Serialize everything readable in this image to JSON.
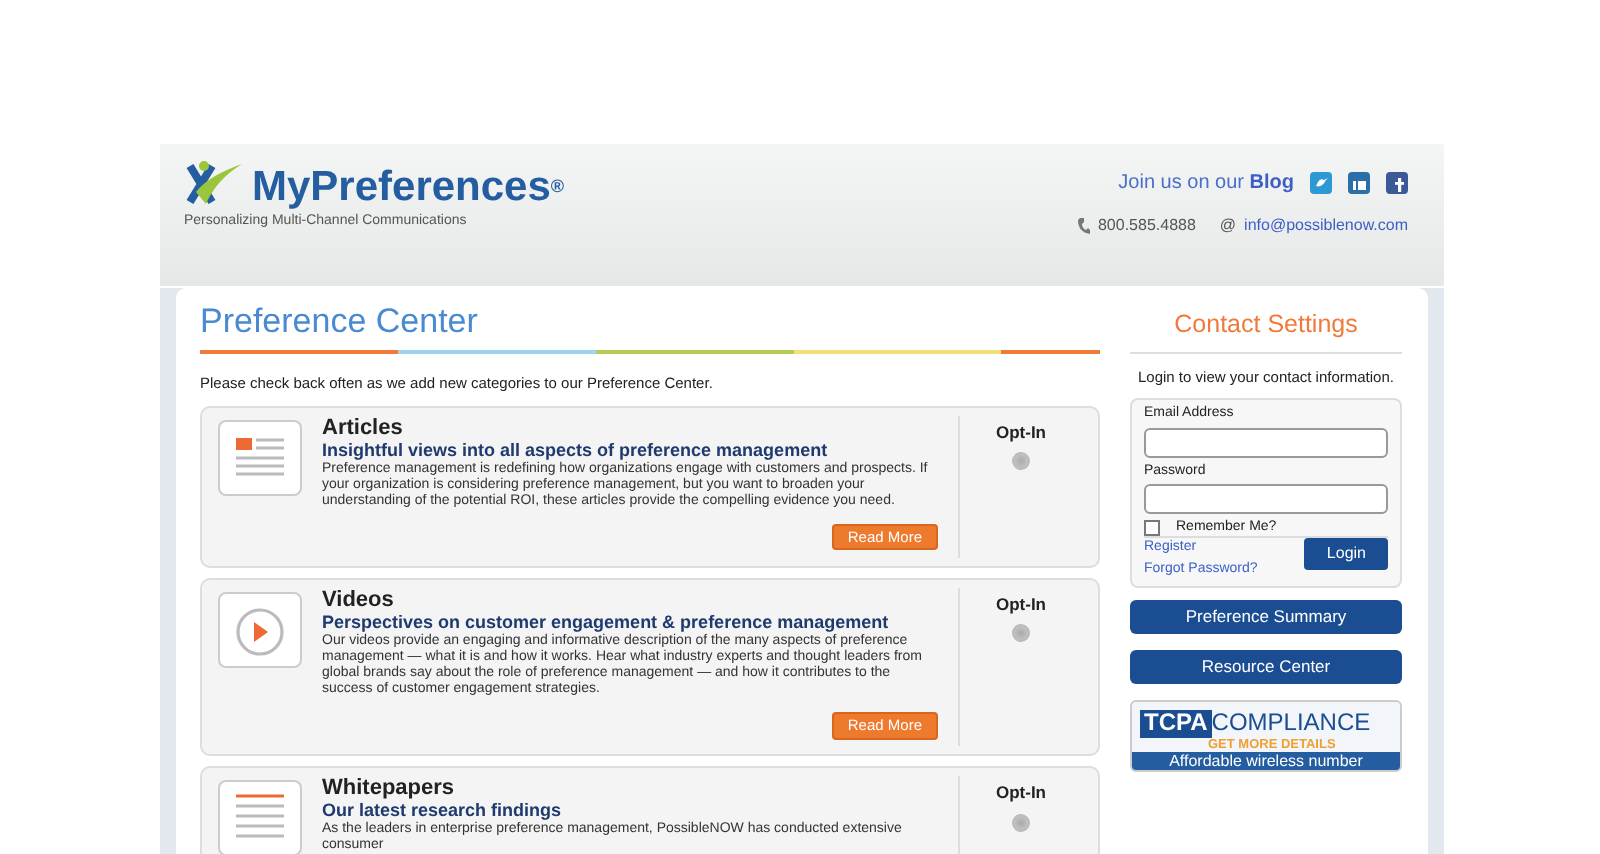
{
  "header": {
    "logo": "MyPreferences$^{®}$",
    "tagline": "Personalizing Multi-Channel Communications",
    "join_text": "Join us on our",
    "blog_link": "Blog",
    "phone": "800.585.4888",
    "email_symbol": "@",
    "email": "info@possiblenow.com"
  },
  "main": {
    "title": "Preference Center",
    "intro": "Please check back often as we add new categories to our Preference Center.",
    "categories": [
      {
        "kind": "articles",
        "title": "Articles",
        "subtitle": "Insightful views into all aspects of preference management",
        "description": "Preference management is redefining how organizations engage with customers and prospects. If your organization is considering preference management, but you want to broaden your understanding of the potential ROI, these articles provide the compelling evidence you need.",
        "button": "Read More",
        "optin_label": "Opt-In",
        "checked": false
      },
      {
        "kind": "videos",
        "title": "Videos",
        "subtitle": "Perspectives on customer engagement & preference management",
        "description": "Our videos provide an engaging and informative description of the many aspects of preference management — what it is and how it works. Hear what industry experts and thought leaders from global brands say about the role of preference management — and how it contributes to the success of customer engagement strategies.",
        "button": "Read More",
        "optin_label": "Opt-In",
        "checked": false
      },
      {
        "kind": "whitepapers",
        "title": "Whitepapers",
        "subtitle": "Our latest research findings",
        "description": "As the leaders in enterprise preference management, PossibleNOW has conducted extensive consumer",
        "optin_label": "Opt-In",
        "checked": false
      }
    ]
  },
  "sidebar": {
    "title": "Contact Settings",
    "intro": "Login to view your contact information.",
    "login": {
      "email_label": "Email Address",
      "password_label": "Password",
      "remember_label": "Remember Me?",
      "remember_checked": false,
      "register": "Register",
      "forgot": "Forgot Password?",
      "login_button": "Login"
    },
    "buttons": [
      "Preference Summary",
      "Resource Center"
    ],
    "banner": {
      "tcpa": "TCPA",
      "compliance": "COMPLIANCE",
      "details": "GET MORE DETAILS",
      "tagline": "Affordable wireless number"
    }
  }
}
